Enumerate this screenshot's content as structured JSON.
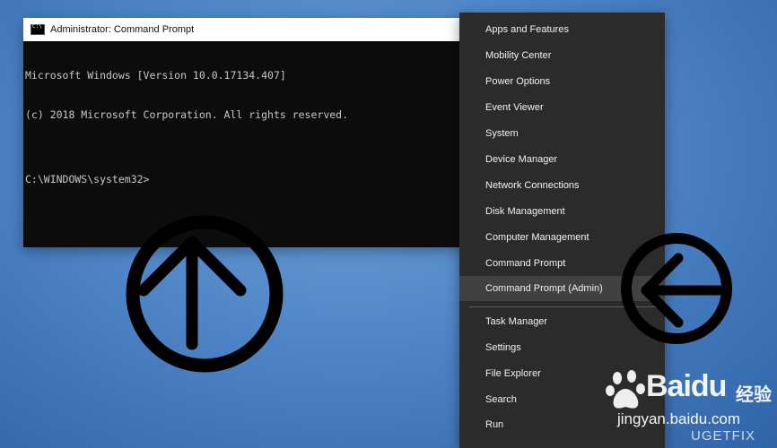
{
  "cmd": {
    "title": "Administrator: Command Prompt",
    "lines": [
      "Microsoft Windows [Version 10.0.17134.407]",
      "(c) 2018 Microsoft Corporation. All rights reserved.",
      "",
      "C:\\WINDOWS\\system32>"
    ]
  },
  "menu": {
    "items": [
      {
        "label": "Apps and Features"
      },
      {
        "label": "Mobility Center"
      },
      {
        "label": "Power Options"
      },
      {
        "label": "Event Viewer"
      },
      {
        "label": "System"
      },
      {
        "label": "Device Manager"
      },
      {
        "label": "Network Connections"
      },
      {
        "label": "Disk Management"
      },
      {
        "label": "Computer Management"
      },
      {
        "label": "Command Prompt"
      },
      {
        "label": "Command Prompt (Admin)",
        "highlighted": true
      },
      {
        "label": "Task Manager"
      },
      {
        "label": "Settings"
      },
      {
        "label": "File Explorer"
      },
      {
        "label": "Search"
      },
      {
        "label": "Run"
      }
    ]
  },
  "watermarks": {
    "baidu_logo": "Baidu",
    "baidu_cn": "经验",
    "baidu_url": "jingyan.baidu.com",
    "ugetfix": "UGETFIX"
  },
  "colors": {
    "menu_bg": "#2b2b2b",
    "menu_highlight": "#414141",
    "console_bg": "#0c0c0c",
    "console_text": "#c8c8c8"
  },
  "icons": {
    "cmd_app": "cmd-app-icon",
    "up_arrow": "up-arrow-circle-icon",
    "left_arrow": "left-arrow-circle-icon"
  }
}
